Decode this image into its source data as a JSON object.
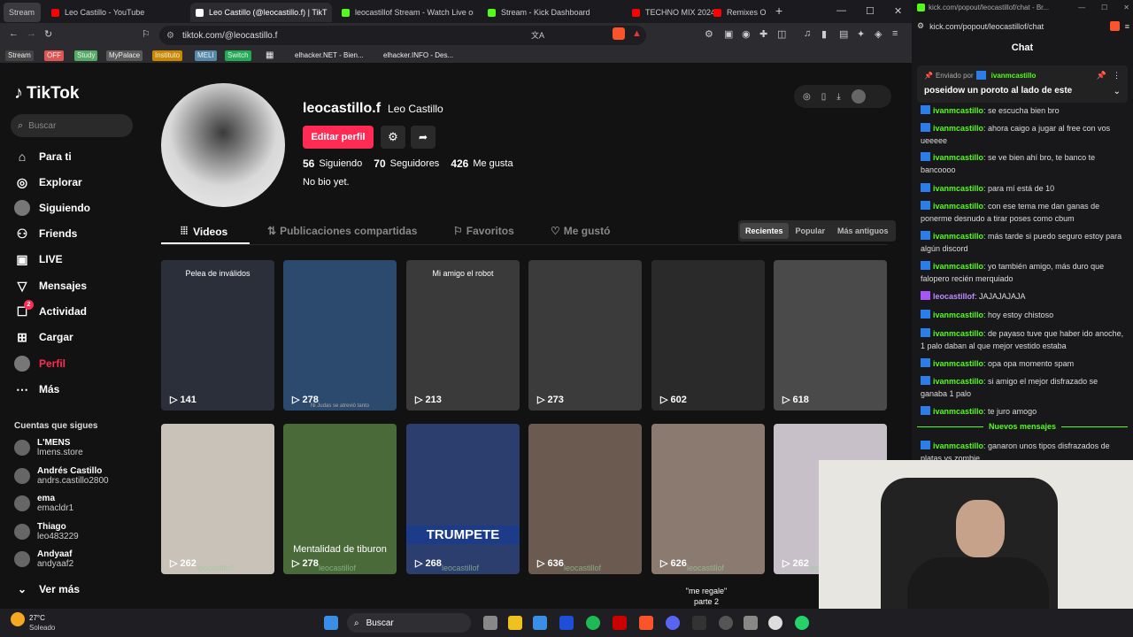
{
  "browser": {
    "tabs": [
      {
        "label": "Stream",
        "color": "#5a5a60"
      },
      {
        "label": "Leo Castillo - YouTube",
        "color": "#ff0000"
      },
      {
        "label": "Leo Castillo (@leocastillo.f) | TikT",
        "color": "#000000"
      },
      {
        "label": "leocastillof Stream - Watch Live on K",
        "color": "#53fc18"
      },
      {
        "label": "Stream - Kick Dashboard",
        "color": "#53fc18"
      },
      {
        "label": "TECHNO MIX 2024",
        "color": "#ff0000"
      },
      {
        "label": "Remixes Of P",
        "color": "#ff0000"
      }
    ],
    "url": "tiktok.com/@leocastillo.f",
    "bookmarks": [
      "Stream",
      "OFF",
      "Study",
      "MyPalace",
      "Instituto",
      "MELI",
      "Switch",
      "elhacker.NET - Bien...",
      "elhacker.INFO - Des..."
    ]
  },
  "tiktok": {
    "logo": "TikTok",
    "search_placeholder": "Buscar",
    "nav": [
      {
        "label": "Para ti",
        "icon": "home-icon",
        "glyph": "⌂"
      },
      {
        "label": "Explorar",
        "icon": "compass-icon",
        "glyph": "◎"
      },
      {
        "label": "Siguiendo",
        "icon": "avatar-icon",
        "glyph": "●"
      },
      {
        "label": "Friends",
        "icon": "people-icon",
        "glyph": "⚇"
      },
      {
        "label": "LIVE",
        "icon": "live-icon",
        "glyph": "▣"
      },
      {
        "label": "Mensajes",
        "icon": "send-icon",
        "glyph": "▽"
      },
      {
        "label": "Actividad",
        "icon": "activity-icon",
        "glyph": "☐"
      },
      {
        "label": "Cargar",
        "icon": "upload-icon",
        "glyph": "⊞"
      },
      {
        "label": "Perfil",
        "icon": "profile-icon",
        "glyph": "●"
      },
      {
        "label": "Más",
        "icon": "more-icon",
        "glyph": "⋯"
      }
    ],
    "activity_badge": "2",
    "following_title": "Cuentas que sigues",
    "following": [
      {
        "name": "L'MENS",
        "user": "lmens.store"
      },
      {
        "name": "Andrés Castillo",
        "user": "andrs.castillo2800"
      },
      {
        "name": "ema",
        "user": "emacldr1"
      },
      {
        "name": "Thiago",
        "user": "leo483229"
      },
      {
        "name": "Andyaaf",
        "user": "andyaaf2"
      }
    ],
    "see_more": "Ver más",
    "profile": {
      "username": "leocastillo.f",
      "display_name": "Leo Castillo",
      "edit_button": "Editar perfil",
      "following_count": "56",
      "following_label": "Siguiendo",
      "followers_count": "70",
      "followers_label": "Seguidores",
      "likes_count": "426",
      "likes_label": "Me gusta",
      "bio": "No bio yet."
    },
    "tabs": [
      "Videos",
      "Publicaciones compartidas",
      "Favoritos",
      "Me gustó"
    ],
    "sort": [
      "Recientes",
      "Popular",
      "Más antiguos"
    ],
    "videos_row1": [
      {
        "views": "141",
        "caption": "Pelea de inválidos"
      },
      {
        "views": "278",
        "caption": "Ni Judas se atrevió tanto"
      },
      {
        "views": "213",
        "caption": "Mi amigo el robot"
      },
      {
        "views": "273",
        "caption": ""
      },
      {
        "views": "602",
        "caption": ""
      },
      {
        "views": "618",
        "caption": ""
      }
    ],
    "videos_row2": [
      {
        "views": "262",
        "caption": ""
      },
      {
        "views": "278",
        "caption": "Mentalidad de tiburon"
      },
      {
        "views": "268",
        "caption": "TRUMPETE"
      },
      {
        "views": "636",
        "caption": ""
      },
      {
        "views": "626",
        "caption": ""
      },
      {
        "views": "262",
        "caption": ""
      }
    ],
    "watermark": "leocastillof",
    "overlay_text": "\"me regale\" parte 2"
  },
  "chat": {
    "url": "kick.com/popout/leocastillof/chat",
    "window_title": "kick.com/popout/leocastillof/chat - Br...",
    "title": "Chat",
    "pinned_by_label": "Enviado por",
    "pinned_by_user": "ivanmcastillo",
    "pinned_text": "poseidow un poroto al lado de este",
    "new_messages": "Nuevos mensajes",
    "messages": [
      {
        "user": "ivanmcastillo",
        "text": "se escucha bien bro"
      },
      {
        "user": "ivanmcastillo",
        "text": "ahora caigo a jugar al free con vos ueeeee"
      },
      {
        "user": "ivanmcastillo",
        "text": "se ve bien ahí bro, te banco te bancoooo"
      },
      {
        "user": "ivanmcastillo",
        "text": "para mí está de 10"
      },
      {
        "user": "ivanmcastillo",
        "text": "con ese tema me dan ganas de ponerme desnudo a tirar poses como cbum"
      },
      {
        "user": "ivanmcastillo",
        "text": "más tarde si puedo seguro estoy para algún discord"
      },
      {
        "user": "ivanmcastillo",
        "text": "yo también amigo, más duro que falopero recién merquiado"
      },
      {
        "user": "leocastillof",
        "text": "JAJAJAJAJA"
      },
      {
        "user": "ivanmcastillo",
        "text": "hoy estoy chistoso"
      },
      {
        "user": "ivanmcastillo",
        "text": "de payaso tuve que haber ido anoche, 1 palo daban al que mejor vestido estaba"
      },
      {
        "user": "ivanmcastillo",
        "text": "opa opa momento spam"
      },
      {
        "user": "ivanmcastillo",
        "text": "si amigo el mejor disfrazado se ganaba 1 palo"
      },
      {
        "user": "ivanmcastillo",
        "text": "te juro amogo"
      }
    ],
    "after_new": {
      "user": "ivanmcastillo",
      "text": "ganaron unos tipos disfrazados de platas vs zombie"
    }
  },
  "taskbar": {
    "weather_temp": "27°C",
    "weather_desc": "Soleado",
    "search": "Buscar"
  },
  "colors": {
    "accent": "#fe2c55",
    "kick_green": "#53fc18"
  }
}
